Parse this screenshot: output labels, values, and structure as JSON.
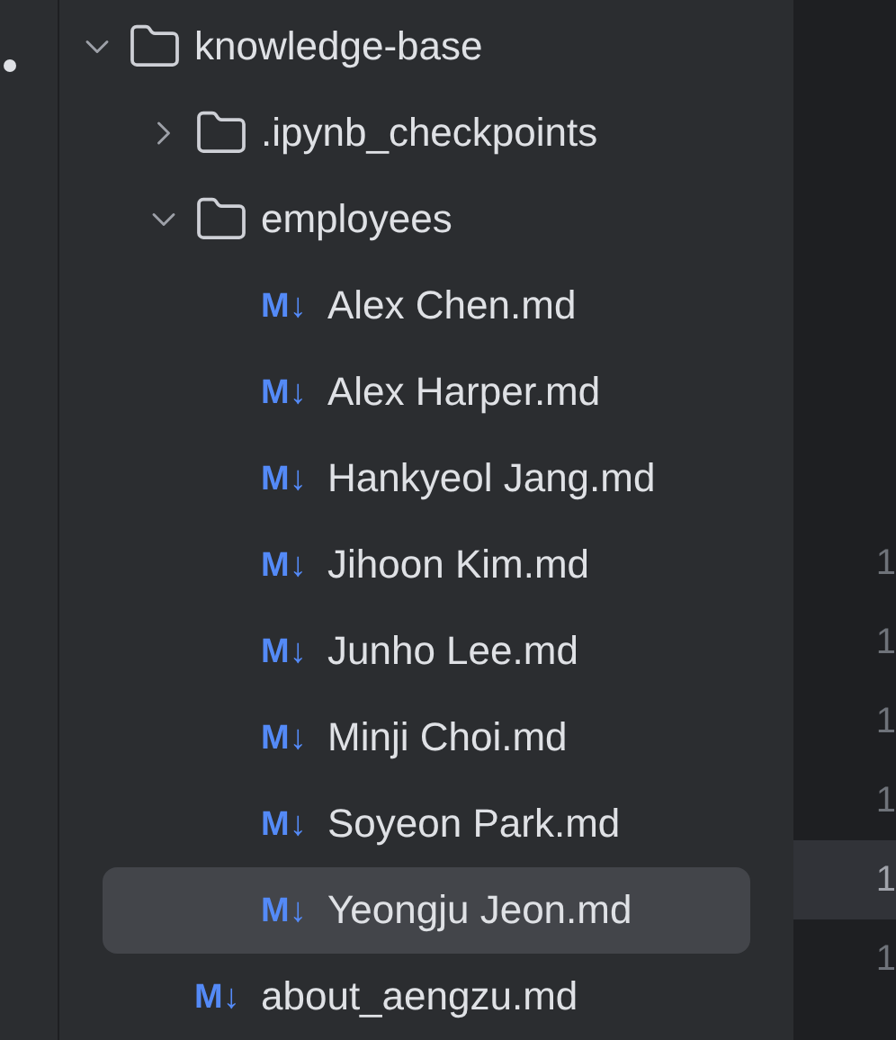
{
  "tree": [
    {
      "kind": "folder",
      "name": "knowledge-base",
      "expanded": true,
      "selected": false,
      "children": [
        {
          "kind": "folder",
          "name": ".ipynb_checkpoints",
          "expanded": false,
          "selected": false
        },
        {
          "kind": "folder",
          "name": "employees",
          "expanded": true,
          "selected": false,
          "children": [
            {
              "kind": "file",
              "icon": "M↓",
              "name": "Alex Chen.md",
              "selected": false
            },
            {
              "kind": "file",
              "icon": "M↓",
              "name": "Alex Harper.md",
              "selected": false
            },
            {
              "kind": "file",
              "icon": "M↓",
              "name": "Hankyeol Jang.md",
              "selected": false
            },
            {
              "kind": "file",
              "icon": "M↓",
              "name": "Jihoon Kim.md",
              "selected": false
            },
            {
              "kind": "file",
              "icon": "M↓",
              "name": "Junho Lee.md",
              "selected": false
            },
            {
              "kind": "file",
              "icon": "M↓",
              "name": "Minji Choi.md",
              "selected": false
            },
            {
              "kind": "file",
              "icon": "M↓",
              "name": "Soyeon Park.md",
              "selected": false
            },
            {
              "kind": "file",
              "icon": "M↓",
              "name": "Yeongju Jeon.md",
              "selected": true
            }
          ]
        },
        {
          "kind": "file",
          "icon": "M↓",
          "name": "about_aengzu.md",
          "selected": false
        }
      ]
    }
  ],
  "line_numbers": [
    {
      "text": "1",
      "current": false
    },
    {
      "text": "1",
      "current": false
    },
    {
      "text": "1",
      "current": false
    },
    {
      "text": "1",
      "current": false
    },
    {
      "text": "1",
      "current": true
    },
    {
      "text": "1",
      "current": false
    }
  ]
}
